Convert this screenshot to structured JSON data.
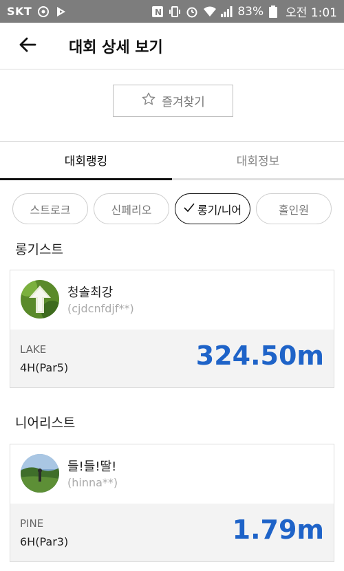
{
  "status_bar": {
    "carrier": "SKT",
    "battery": "83%",
    "time": "오전 1:01"
  },
  "header": {
    "title": "대회 상세 보기"
  },
  "favorite": {
    "label": "즐겨찾기"
  },
  "tabs": [
    {
      "label": "대회랭킹",
      "active": true
    },
    {
      "label": "대회정보",
      "active": false
    }
  ],
  "filters": [
    {
      "label": "스트로크",
      "active": false
    },
    {
      "label": "신페리오",
      "active": false
    },
    {
      "label": "롱기/니어",
      "active": true
    },
    {
      "label": "홀인원",
      "active": false
    }
  ],
  "longest": {
    "section_title": "롱기스트",
    "name": "청솔최강",
    "user_id": "(cjdcnfdjf**)",
    "course": "LAKE",
    "hole": "4H(Par5)",
    "distance": "324.50m"
  },
  "nearest": {
    "section_title": "니어리스트",
    "name": "들!들!딸!",
    "user_id": "(hinna**)",
    "course": "PINE",
    "hole": "6H(Par3)",
    "distance": "1.79m"
  },
  "colors": {
    "accent": "#1e63c8",
    "status_bar": "#7d7d7d"
  }
}
